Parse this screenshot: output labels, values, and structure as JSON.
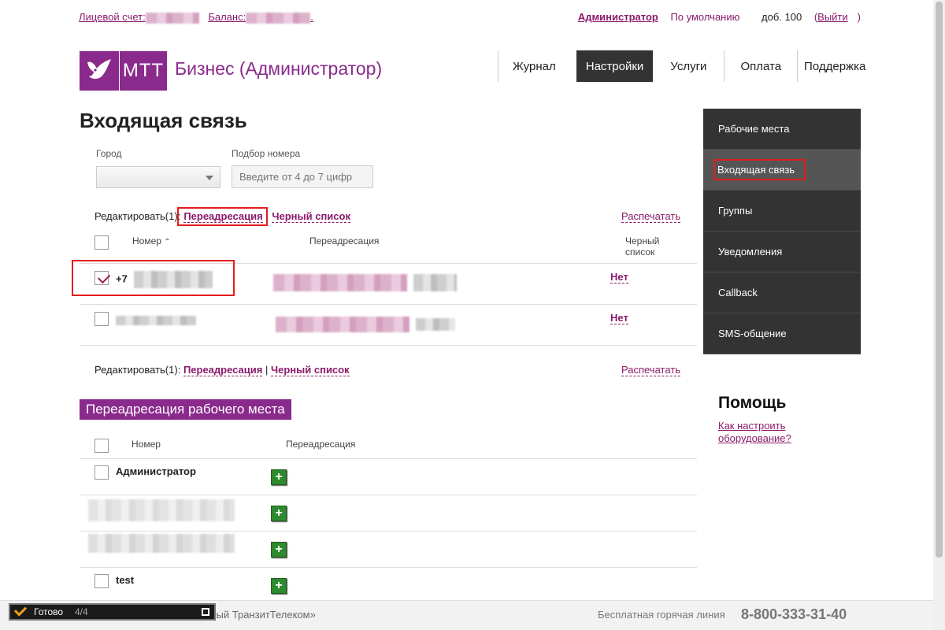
{
  "topbar": {
    "account_label": "Лицевой счет:",
    "balance_label": "Баланс:",
    "balance_suffix": ".",
    "user": "Администратор",
    "profile": "По умолчанию",
    "ext": "доб. 100",
    "logout_open": "(",
    "logout": "Выйти",
    "logout_close": ")"
  },
  "header": {
    "logo_text": "МТТ",
    "brand": "Бизнес (Администратор)",
    "nav": [
      {
        "label": "Журнал"
      },
      {
        "label": "Настройки"
      },
      {
        "label": "Услуги"
      },
      {
        "label": "Оплата"
      },
      {
        "label": "Поддержка"
      }
    ]
  },
  "page": {
    "title": "Входящая связь",
    "filters": {
      "city_label": "Город",
      "number_label": "Подбор номера",
      "number_placeholder": "Введите от 4 до 7 цифр"
    },
    "edit": {
      "prefix": "Редактировать(1):",
      "redirect": "Переадресация",
      "separator": "|",
      "blacklist": "Черный список",
      "print": "Распечатать"
    },
    "table": {
      "col_number": "Номер",
      "sort_icon": "chevron-up-icon",
      "col_redirect": "Переадресация",
      "col_blacklist_1": "Черный",
      "col_blacklist_2": "список",
      "rows": [
        {
          "number_prefix": "+7",
          "checked": true,
          "blacklist": "Нет"
        },
        {
          "number_prefix": "",
          "checked": false,
          "blacklist": "Нет"
        }
      ]
    },
    "workplace": {
      "title": "Переадресация рабочего места",
      "col_number": "Номер",
      "col_redirect": "Переадресация",
      "rows": [
        {
          "name": "Администратор"
        },
        {
          "name": ""
        },
        {
          "name": ""
        },
        {
          "name": "test"
        }
      ],
      "add_icon": "+"
    }
  },
  "sidebar": {
    "items": [
      {
        "label": "Рабочие места"
      },
      {
        "label": "Входящая связь"
      },
      {
        "label": "Группы"
      },
      {
        "label": "Уведомления"
      },
      {
        "label": "Callback"
      },
      {
        "label": "SMS-общение"
      }
    ]
  },
  "help": {
    "title": "Помощь",
    "link": "Как настроить оборудование?"
  },
  "footer": {
    "company": "льный ТранзитТелеком»",
    "hotline": "Бесплатная горячая линия",
    "phone": "8-800-333-31-40"
  },
  "statusbar": {
    "label": "Готово",
    "count": "4/4"
  },
  "colors": {
    "brand": "#8a2a8c",
    "link": "#8a1a6b",
    "highlight": "#e21d1d",
    "add_button": "#2e8a2e"
  }
}
